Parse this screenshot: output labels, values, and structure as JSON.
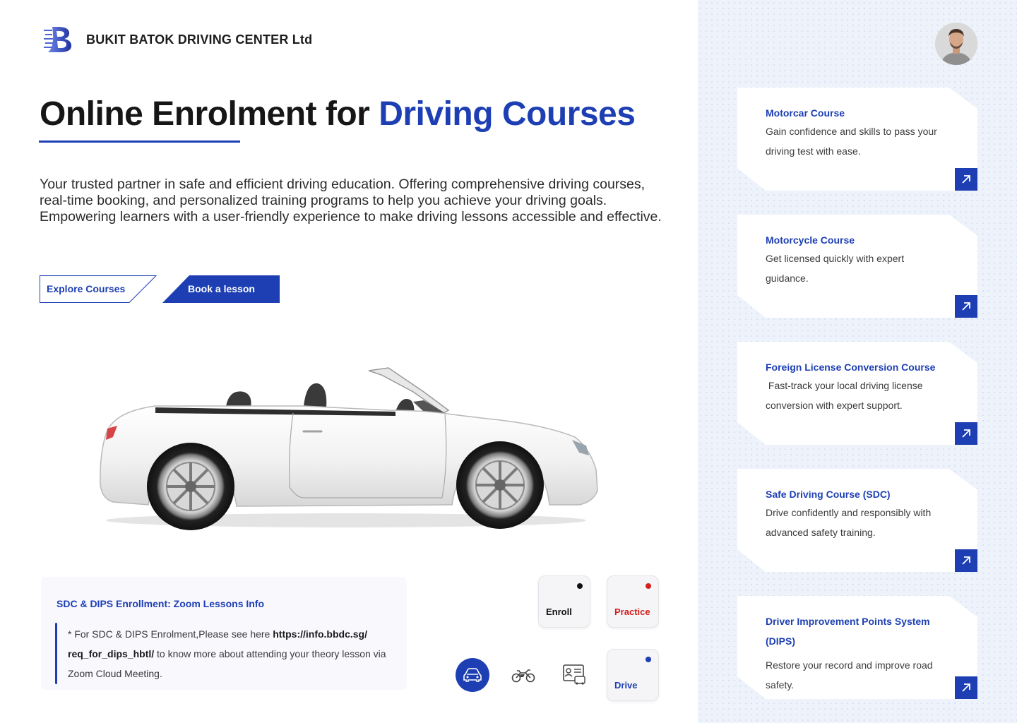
{
  "brand": {
    "name": "BUKIT BATOK DRIVING CENTER Ltd"
  },
  "hero": {
    "title_prefix": "Online Enrolment for ",
    "title_accent": "Driving Courses",
    "description": "Your trusted partner in safe and efficient driving education. Offering comprehensive driving courses, real-time booking, and personalized training programs to help you achieve your driving goals. Empowering learners with a user-friendly experience to make driving lessons accessible and effective."
  },
  "buttons": {
    "explore": "Explore Courses",
    "book": "Book a lesson"
  },
  "info": {
    "title": "SDC & DIPS Enrollment: Zoom Lessons Info",
    "text_before": "* For SDC & DIPS Enrolment,Please see here ",
    "link": "https://info.bbdc.sg/ req_for_dips_hbtl/",
    "text_after": " to know more about attending your theory lesson via Zoom Cloud Meeting."
  },
  "actions": [
    {
      "label": "Enroll",
      "dot_color": "#111111",
      "label_color": "#111111"
    },
    {
      "label": "Practice",
      "dot_color": "#d42020",
      "label_color": "#d42020"
    },
    {
      "label": "Drive",
      "dot_color": "#1d3fb3",
      "label_color": "#1d3fb3"
    }
  ],
  "modes": [
    {
      "icon": "car-icon",
      "active": true
    },
    {
      "icon": "motorcycle-icon",
      "active": false
    },
    {
      "icon": "license-card-icon",
      "active": false
    }
  ],
  "courses": [
    {
      "title": "Motorcar Course",
      "desc": "Gain confidence and skills to pass your driving test with ease."
    },
    {
      "title": "Motorcycle Course",
      "desc": "Get licensed quickly with expert guidance."
    },
    {
      "title": "Foreign License Conversion Course",
      "desc": " Fast-track your local driving license conversion with expert support."
    },
    {
      "title": "Safe Driving Course (SDC)",
      "desc": "Drive confidently and responsibly with advanced safety training."
    },
    {
      "title": "Driver Improvement Points System (DIPS)",
      "desc": "Restore your record and improve road safety."
    }
  ],
  "colors": {
    "accent": "#1d3fb3",
    "panel_bg": "#edf2fb"
  }
}
